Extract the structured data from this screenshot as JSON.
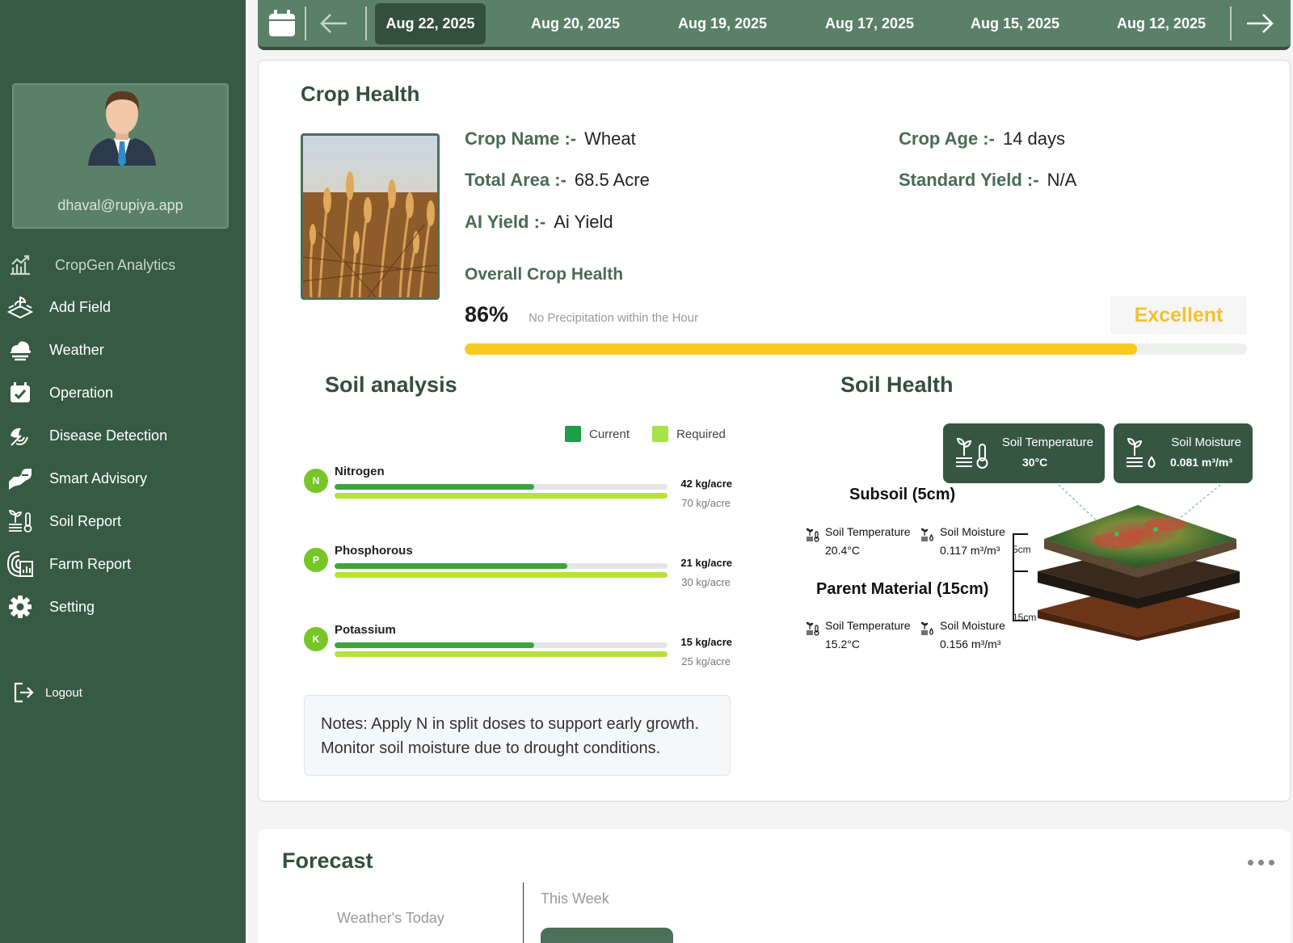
{
  "sidebar": {
    "profile": {
      "email": "dhaval@rupiya.app"
    },
    "items": [
      {
        "label": "CropGen Analytics",
        "icon": "analytics-icon"
      },
      {
        "label": "Add Field",
        "icon": "add-field-icon"
      },
      {
        "label": "Weather",
        "icon": "weather-icon"
      },
      {
        "label": "Operation",
        "icon": "operation-icon"
      },
      {
        "label": "Disease Detection",
        "icon": "disease-detection-icon"
      },
      {
        "label": "Smart Advisory",
        "icon": "smart-advisory-icon"
      },
      {
        "label": "Soil Report",
        "icon": "soil-report-icon"
      },
      {
        "label": "Farm Report",
        "icon": "farm-report-icon"
      },
      {
        "label": "Setting",
        "icon": "gear-icon"
      }
    ],
    "logout": "Logout"
  },
  "datebar": {
    "dates": [
      "Aug 22, 2025",
      "Aug 20, 2025",
      "Aug 19, 2025",
      "Aug 17, 2025",
      "Aug 15, 2025",
      "Aug 12, 2025"
    ],
    "selected_index": 0
  },
  "crop_health": {
    "title": "Crop Health",
    "crop_name_label": "Crop Name :-",
    "crop_name": "Wheat",
    "crop_age_label": "Crop Age :-",
    "crop_age": "14 days",
    "total_area_label": "Total Area :-",
    "total_area": "68.5 Acre",
    "standard_yield_label": "Standard Yield :-",
    "standard_yield": "N/A",
    "ai_yield_label": "AI Yield :-",
    "ai_yield": "Ai Yield",
    "overall_label": "Overall Crop Health",
    "overall_pct_text": "86%",
    "overall_pct": 86,
    "precip_text": "No Precipitation within the Hour",
    "status": "Excellent"
  },
  "soil_analysis": {
    "title": "Soil analysis",
    "legend": {
      "current": "Current",
      "required": "Required"
    },
    "colors": {
      "current": "#3da43b",
      "required": "#b7e13b",
      "legend_current": "#1e9e48",
      "legend_required": "#a6e249"
    },
    "nutrients": [
      {
        "letter": "N",
        "name": "Nitrogen",
        "current": 42,
        "required": 70,
        "current_text": "42 kg/acre",
        "required_text": "70 kg/acre"
      },
      {
        "letter": "P",
        "name": "Phosphorous",
        "current": 21,
        "required": 30,
        "current_text": "21 kg/acre",
        "required_text": "30 kg/acre"
      },
      {
        "letter": "K",
        "name": "Potassium",
        "current": 15,
        "required": 25,
        "current_text": "15 kg/acre",
        "required_text": "25 kg/acre"
      }
    ],
    "notes": "Notes: Apply N in split doses to support early growth. Monitor soil moisture due to drought conditions."
  },
  "soil_health": {
    "title": "Soil Health",
    "temp_card": {
      "label": "Soil Temperature",
      "value": "30°C"
    },
    "moisture_card": {
      "label": "Soil Moisture",
      "value": "0.081 m³/m³"
    },
    "subsoil": {
      "title": "Subsoil (5cm)",
      "temp_label": "Soil Temperature",
      "temp": "20.4°C",
      "moisture_label": "Soil Moisture",
      "moisture": "0.117 m³/m³",
      "depth": "5cm"
    },
    "parent": {
      "title": "Parent Material (15cm)",
      "temp_label": "Soil Temperature",
      "temp": "15.2°C",
      "moisture_label": "Soil Moisture",
      "moisture": "0.156 m³/m³",
      "depth": "15cm"
    }
  },
  "forecast": {
    "title": "Forecast",
    "weather_today": "Weather's Today",
    "this_week": "This Week"
  }
}
